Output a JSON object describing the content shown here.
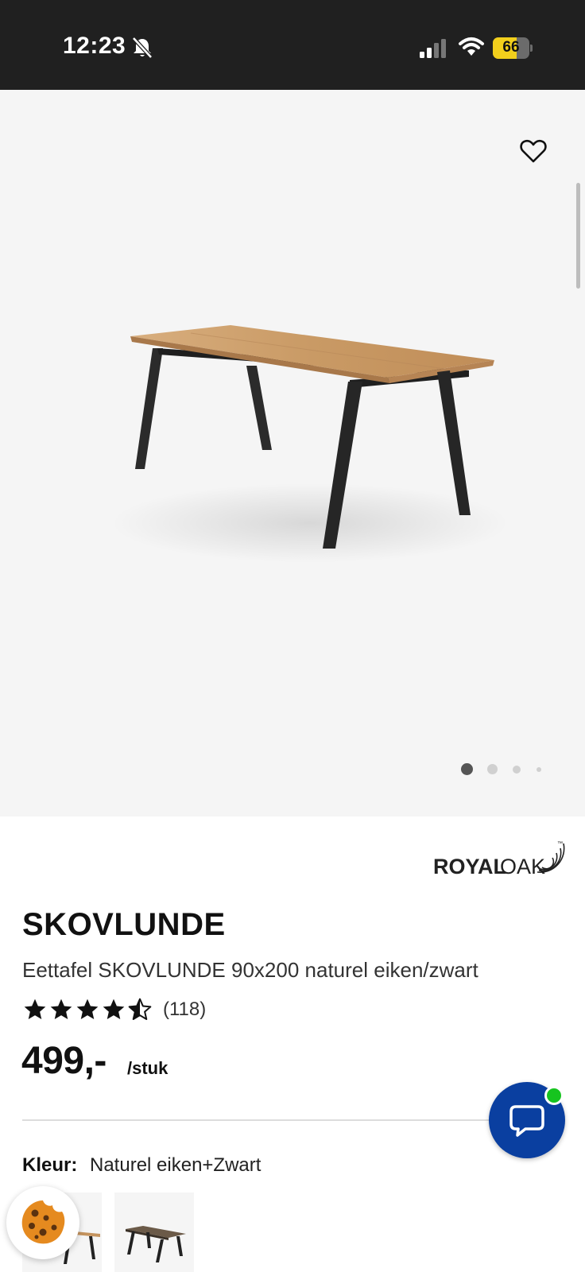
{
  "status_bar": {
    "time": "12:23",
    "battery_level": "66",
    "battery_fraction": 0.66,
    "icons": [
      "bell-off-icon",
      "signal-icon",
      "wifi-icon",
      "battery-icon"
    ]
  },
  "gallery": {
    "image": "table-image",
    "current_slide": 1,
    "slide_count": 4,
    "favorite_icon": "heart-icon"
  },
  "product": {
    "brand": {
      "royal": "ROYAL",
      "oak": "OAK",
      "tm": "™"
    },
    "title": "SKOVLUNDE",
    "subtitle": "Eettafel SKOVLUNDE 90x200 naturel eiken/zwart",
    "rating": 4.5,
    "review_count": "(118)",
    "price": "499,-",
    "price_unit": "/stuk"
  },
  "colour": {
    "label": "Kleur:",
    "value": "Naturel eiken+Zwart",
    "swatches": [
      "naturel-eiken-zwart",
      "donker-zwart"
    ]
  },
  "colors": {
    "status_bar_bg": "#202020",
    "gallery_bg": "#f5f5f5",
    "chat_blue": "#0a3fa0",
    "online_green": "#16c41f",
    "battery_yellow": "#f2cf1c",
    "cookie_orange": "#e58a1f"
  }
}
